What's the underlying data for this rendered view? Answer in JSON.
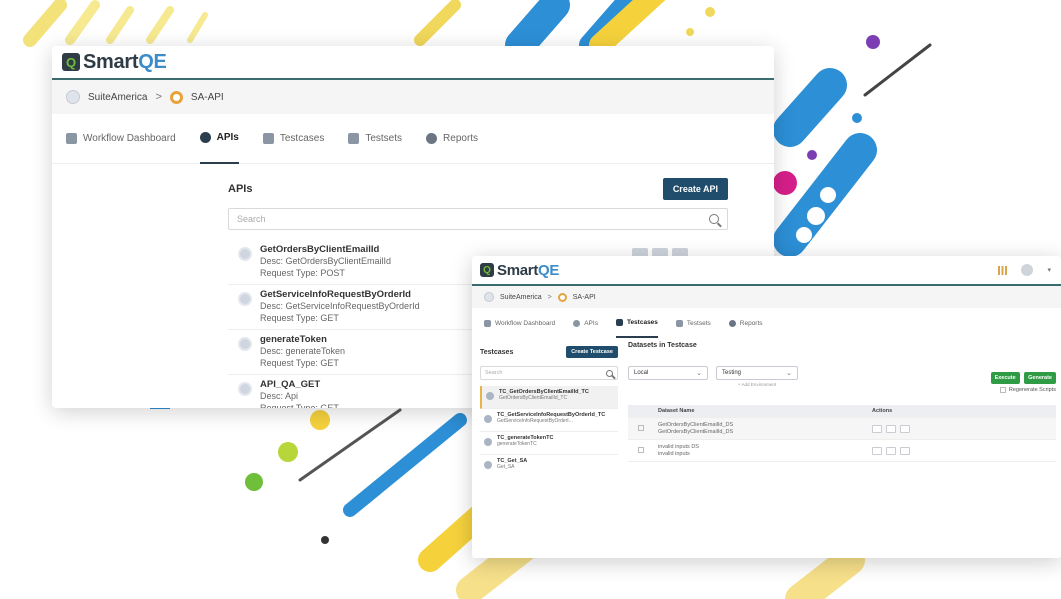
{
  "window_main": {
    "logo": {
      "brand": "Smart",
      "brand_accent": "QE"
    },
    "breadcrumb": {
      "root": "SuiteAmerica",
      "separator": ">",
      "current": "SA-API"
    },
    "tabs": [
      {
        "label": "Workflow Dashboard",
        "active": false
      },
      {
        "label": "APIs",
        "active": true
      },
      {
        "label": "Testcases",
        "active": false
      },
      {
        "label": "Testsets",
        "active": false
      },
      {
        "label": "Reports",
        "active": false
      }
    ],
    "apis": {
      "title": "APIs",
      "create_button": "Create API",
      "search_placeholder": "Search",
      "items": [
        {
          "name": "GetOrdersByClientEmailId",
          "desc": "Desc: GetOrdersByClientEmailId",
          "type": "Request Type: POST"
        },
        {
          "name": "GetServiceInfoRequestByOrderId",
          "desc": "Desc: GetServiceInfoRequestByOrderId",
          "type": "Request Type: GET"
        },
        {
          "name": "generateToken",
          "desc": "Desc: generateToken",
          "type": "Request Type: GET"
        },
        {
          "name": "API_QA_GET",
          "desc": "Desc: Api",
          "type": "Request Type: GET"
        }
      ]
    }
  },
  "window_detail": {
    "logo": {
      "brand": "Smart",
      "brand_accent": "QE"
    },
    "breadcrumb": {
      "root": "SuiteAmerica",
      "separator": ">",
      "current": "SA-API"
    },
    "tabs": [
      {
        "label": "Workflow Dashboard",
        "active": false
      },
      {
        "label": "APIs",
        "active": false
      },
      {
        "label": "Testcases",
        "active": true
      },
      {
        "label": "Testsets",
        "active": false
      },
      {
        "label": "Reports",
        "active": false
      }
    ],
    "testcases": {
      "title": "Testcases",
      "create_button": "Create Testcase",
      "search_placeholder": "Search",
      "items": [
        {
          "name": "TC_GetOrdersByClientEmailId_TC",
          "desc": "GetOrdersByClientEmailId_TC",
          "selected": true
        },
        {
          "name": "TC_GetServiceInfoRequestByOrderId_TC",
          "desc": "GetServiceInfoRequestByOrderI...",
          "selected": false
        },
        {
          "name": "TC_generateTokenTC",
          "desc": "generateTokenTC",
          "selected": false
        },
        {
          "name": "TC_Get_SA",
          "desc": "Get_SA",
          "selected": false
        }
      ]
    },
    "datasets": {
      "title": "Datasets in Testcase",
      "env_select": "Local",
      "type_select": "Testing",
      "add_environment": "+ Add Environment",
      "execute_button": "Execute",
      "generate_button": "Generate",
      "regenerate_label": "Regenerate Scripts",
      "columns": {
        "name": "Dataset Name",
        "actions": "Actions"
      },
      "rows": [
        {
          "line1": "GetOrdersByClientEmailId_DS",
          "line2": "GetOrdersByClientEmailId_DS"
        },
        {
          "line1": "invalid inputs DS",
          "line2": "invalid inputs"
        }
      ]
    }
  },
  "colors": {
    "brand_dark": "#2f3b45",
    "brand_blue": "#3c8cc9",
    "primary_button": "#1f4d6b",
    "execute_green": "#2f9b45",
    "accent_orange": "#e8a33a"
  }
}
